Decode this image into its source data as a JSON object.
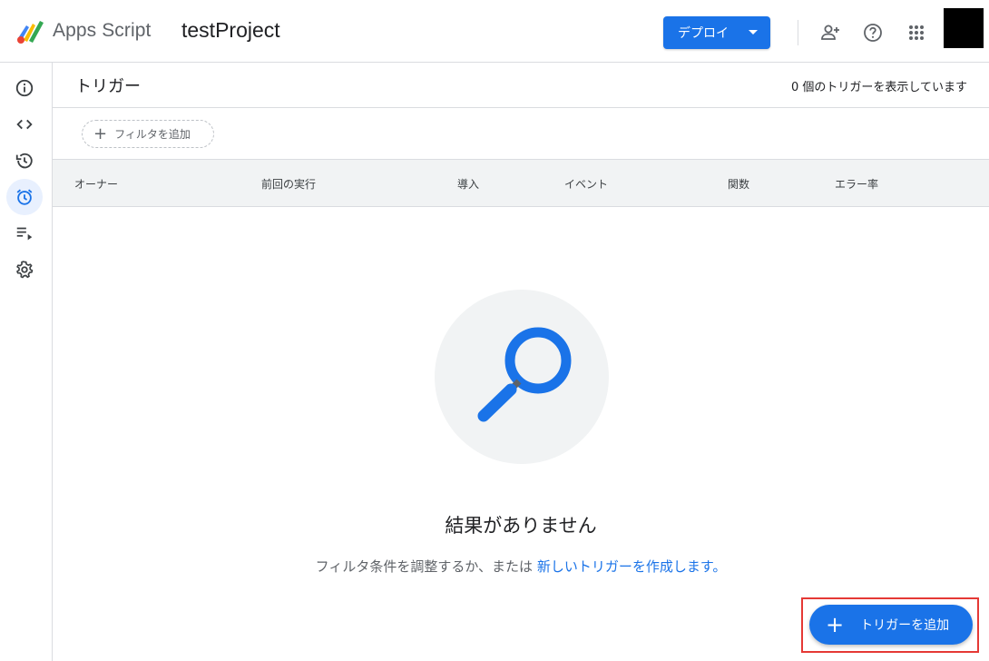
{
  "header": {
    "brand": "Apps Script",
    "project": "testProject",
    "deploy_label": "デプロイ"
  },
  "icons": {
    "logo": "apps-script-logo",
    "add_person": "person-add-icon",
    "help": "help-icon",
    "apps": "apps-grid-icon",
    "rail": [
      "info-icon",
      "code-icon",
      "history-icon",
      "alarm-icon",
      "playlist-play-icon",
      "gear-icon"
    ]
  },
  "colors": {
    "accent": "#1a73e8",
    "highlight": "#e53935"
  },
  "main": {
    "title": "トリガー",
    "count_text": "0 個のトリガーを表示しています",
    "filter_label": "フィルタを追加",
    "columns": [
      "オーナー",
      "前回の実行",
      "導入",
      "イベント",
      "関数",
      "エラー率"
    ],
    "empty_title": "結果がありません",
    "empty_desc_prefix": "フィルタ条件を調整するか、または ",
    "empty_desc_link": "新しいトリガーを作成します。",
    "fab_label": "トリガーを追加"
  }
}
